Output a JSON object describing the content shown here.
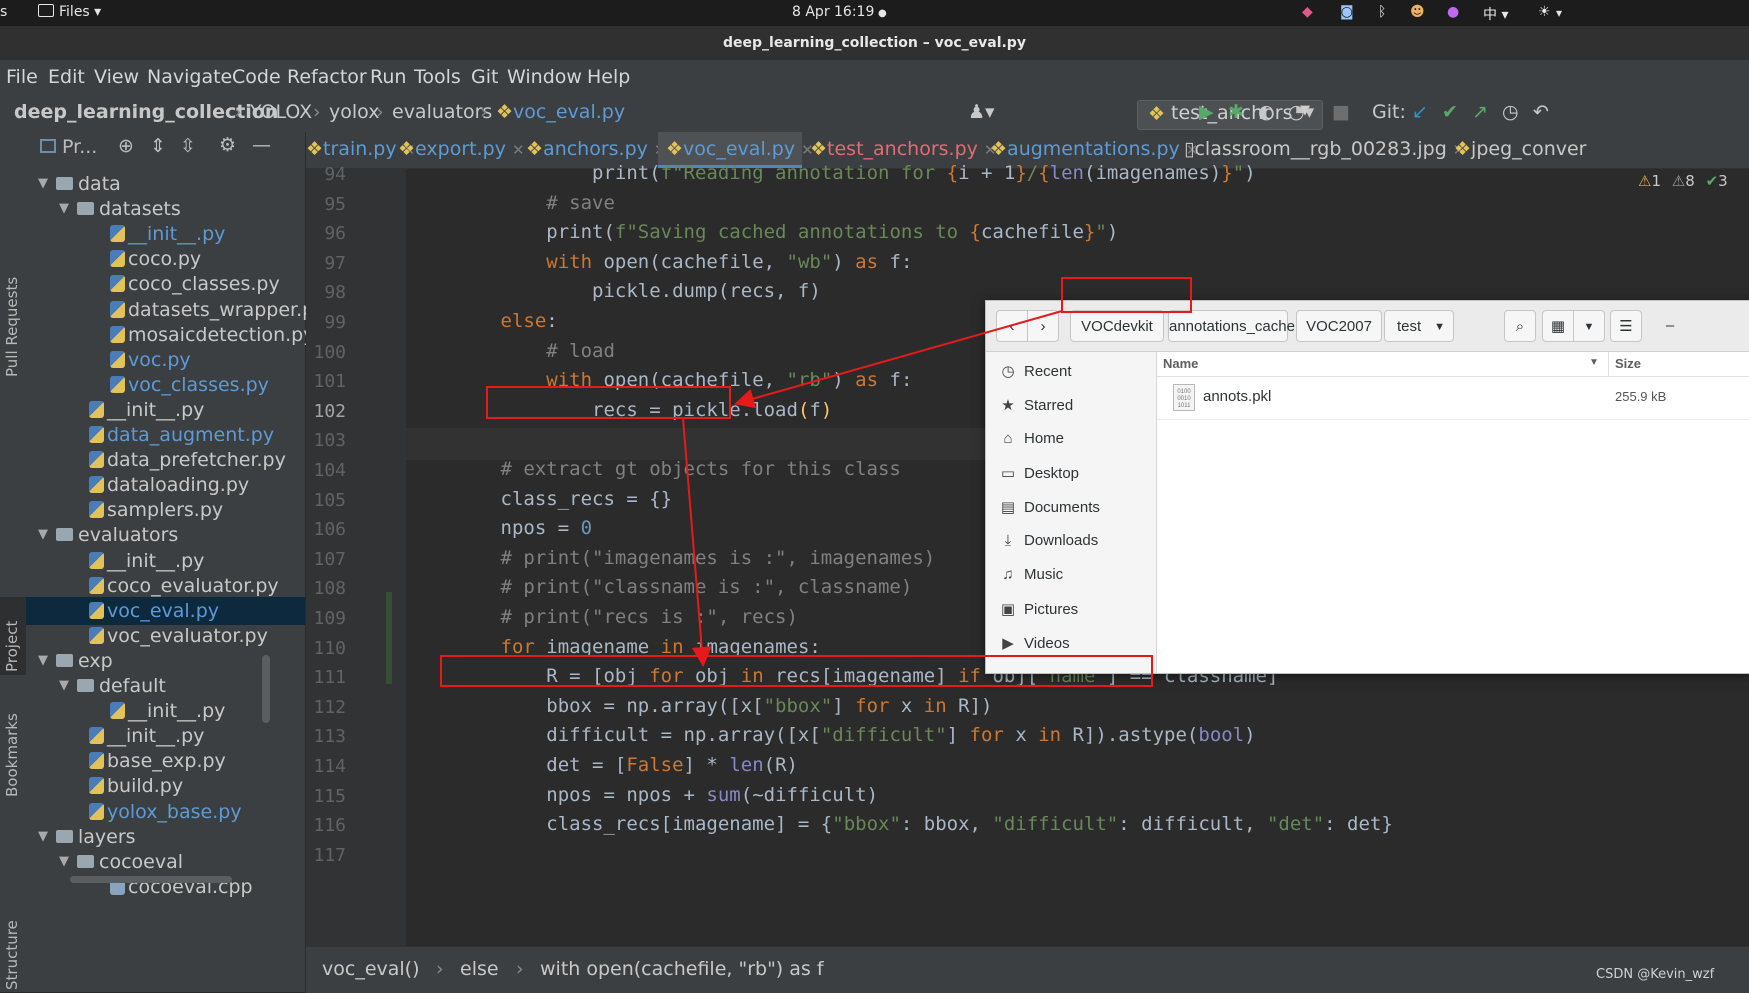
{
  "system_bar": {
    "activities": "s",
    "files_menu": "Files ▾",
    "datetime": "8 Apr  16:19",
    "input_method": "中 ▾"
  },
  "window": {
    "title": "deep_learning_collection – voc_eval.py"
  },
  "menu": [
    "File",
    "Edit",
    "View",
    "Navigate",
    "Code",
    "Refactor",
    "Run",
    "Tools",
    "Git",
    "Window",
    "Help"
  ],
  "breadcrumb": [
    "deep_learning_collection",
    "YOLOX",
    "yolox",
    "evaluators",
    "voc_eval.py"
  ],
  "toolbar": {
    "run_config": "test_anchors",
    "git_label": "Git:"
  },
  "project_panel": {
    "title": "Pr...",
    "tree": [
      {
        "label": "data",
        "type": "folder",
        "depth": 0,
        "expanded": true
      },
      {
        "label": "datasets",
        "type": "folder",
        "depth": 1,
        "expanded": true
      },
      {
        "label": "__init__.py",
        "type": "py",
        "depth": 2,
        "color": "blue"
      },
      {
        "label": "coco.py",
        "type": "py",
        "depth": 2
      },
      {
        "label": "coco_classes.py",
        "type": "py",
        "depth": 2
      },
      {
        "label": "datasets_wrapper.p",
        "type": "py",
        "depth": 2
      },
      {
        "label": "mosaicdetection.py",
        "type": "py",
        "depth": 2
      },
      {
        "label": "voc.py",
        "type": "py",
        "depth": 2,
        "color": "blue"
      },
      {
        "label": "voc_classes.py",
        "type": "py",
        "depth": 2,
        "color": "blue"
      },
      {
        "label": "__init__.py",
        "type": "py",
        "depth": 1
      },
      {
        "label": "data_augment.py",
        "type": "py",
        "depth": 1,
        "color": "blue"
      },
      {
        "label": "data_prefetcher.py",
        "type": "py",
        "depth": 1
      },
      {
        "label": "dataloading.py",
        "type": "py",
        "depth": 1
      },
      {
        "label": "samplers.py",
        "type": "py",
        "depth": 1
      },
      {
        "label": "evaluators",
        "type": "folder",
        "depth": 0,
        "expanded": true
      },
      {
        "label": "__init__.py",
        "type": "py",
        "depth": 1
      },
      {
        "label": "coco_evaluator.py",
        "type": "py",
        "depth": 1
      },
      {
        "label": "voc_eval.py",
        "type": "py",
        "depth": 1,
        "color": "blue",
        "selected": true
      },
      {
        "label": "voc_evaluator.py",
        "type": "py",
        "depth": 1
      },
      {
        "label": "exp",
        "type": "folder",
        "depth": 0,
        "expanded": true
      },
      {
        "label": "default",
        "type": "folder",
        "depth": 1,
        "expanded": true
      },
      {
        "label": "__init__.py",
        "type": "py",
        "depth": 2
      },
      {
        "label": "__init__.py",
        "type": "py",
        "depth": 1
      },
      {
        "label": "base_exp.py",
        "type": "py",
        "depth": 1
      },
      {
        "label": "build.py",
        "type": "py",
        "depth": 1
      },
      {
        "label": "yolox_base.py",
        "type": "py",
        "depth": 1,
        "color": "blue"
      },
      {
        "label": "layers",
        "type": "folder",
        "depth": 0,
        "expanded": true
      },
      {
        "label": "cocoeval",
        "type": "folder",
        "depth": 1,
        "expanded": true
      },
      {
        "label": "cocoeval.cpp",
        "type": "cpp",
        "depth": 2
      }
    ]
  },
  "side_labels": {
    "pull_requests": "Pull Requests",
    "project": "Project",
    "bookmarks": "Bookmarks",
    "structure": "Structure"
  },
  "tabs": [
    {
      "label": "train.py"
    },
    {
      "label": "export.py"
    },
    {
      "label": "anchors.py",
      "color": "blue"
    },
    {
      "label": "voc_eval.py",
      "color": "blue",
      "active": true
    },
    {
      "label": "test_anchors.py",
      "color": "red"
    },
    {
      "label": "augmentations.py",
      "color": "blue"
    },
    {
      "label": "classroom__rgb_00283.jpg"
    },
    {
      "label": "jpeg_conver"
    }
  ],
  "inspections": {
    "warnings_a": "1",
    "warnings_b": "8",
    "ok": "3"
  },
  "code": {
    "line_numbers": [
      "94",
      "95",
      "96",
      "97",
      "98",
      "99",
      "100",
      "101",
      "102",
      "103",
      "104",
      "105",
      "106",
      "107",
      "108",
      "109",
      "110",
      "111",
      "112",
      "113",
      "114",
      "115",
      "116",
      "117"
    ],
    "lines": [
      [
        {
          "t": "                print(",
          "c": ""
        },
        {
          "t": "f\"Reading annotation for ",
          "c": "str"
        },
        {
          "t": "{",
          "c": "kw"
        },
        {
          "t": "i + 1",
          "c": ""
        },
        {
          "t": "}",
          "c": "kw"
        },
        {
          "t": "/",
          "c": "str"
        },
        {
          "t": "{",
          "c": "kw"
        },
        {
          "t": "len",
          "c": "fn"
        },
        {
          "t": "(imagenames)",
          "c": ""
        },
        {
          "t": "}",
          "c": "kw"
        },
        {
          "t": "\"",
          "c": "str"
        },
        {
          "t": ")",
          "c": ""
        }
      ],
      [
        {
          "t": "            # save",
          "c": "cm"
        }
      ],
      [
        {
          "t": "            print(",
          "c": ""
        },
        {
          "t": "f\"Saving cached annotations to ",
          "c": "str"
        },
        {
          "t": "{",
          "c": "kw"
        },
        {
          "t": "cachefile",
          "c": ""
        },
        {
          "t": "}",
          "c": "kw"
        },
        {
          "t": "\"",
          "c": "str"
        },
        {
          "t": ")",
          "c": ""
        }
      ],
      [
        {
          "t": "            ",
          "c": ""
        },
        {
          "t": "with ",
          "c": "kw"
        },
        {
          "t": "open(cachefile, ",
          "c": ""
        },
        {
          "t": "\"wb\"",
          "c": "str"
        },
        {
          "t": ") ",
          "c": ""
        },
        {
          "t": "as ",
          "c": "kw"
        },
        {
          "t": "f:",
          "c": ""
        }
      ],
      [
        {
          "t": "                pickle.dump(recs, f)",
          "c": ""
        }
      ],
      [
        {
          "t": "        ",
          "c": ""
        },
        {
          "t": "else",
          "c": "kw"
        },
        {
          "t": ":",
          "c": ""
        }
      ],
      [
        {
          "t": "            # load",
          "c": "cm"
        }
      ],
      [
        {
          "t": "            ",
          "c": ""
        },
        {
          "t": "with ",
          "c": "kw"
        },
        {
          "t": "open(cachefile, ",
          "c": ""
        },
        {
          "t": "\"rb\"",
          "c": "str"
        },
        {
          "t": ") ",
          "c": ""
        },
        {
          "t": "as ",
          "c": "kw"
        },
        {
          "t": "f:",
          "c": ""
        }
      ],
      [
        {
          "t": "                recs = pickle.load",
          "c": ""
        },
        {
          "t": "(",
          "c": "fs"
        },
        {
          "t": "f",
          "c": ""
        },
        {
          "t": ")",
          "c": "fs"
        }
      ],
      [
        {
          "t": "",
          "c": ""
        }
      ],
      [
        {
          "t": "        # extract gt objects for this class",
          "c": "cm"
        }
      ],
      [
        {
          "t": "        class_recs = {}",
          "c": ""
        }
      ],
      [
        {
          "t": "        npos = ",
          "c": ""
        },
        {
          "t": "0",
          "c": "num"
        }
      ],
      [
        {
          "t": "        # print(\"imagenames is :\", imagenames)",
          "c": "cm"
        }
      ],
      [
        {
          "t": "        # print(\"classname is :\", classname)",
          "c": "cm"
        }
      ],
      [
        {
          "t": "        # print(\"recs is :\", recs)",
          "c": "cm"
        }
      ],
      [
        {
          "t": "        ",
          "c": ""
        },
        {
          "t": "for ",
          "c": "kw"
        },
        {
          "t": "imagename ",
          "c": ""
        },
        {
          "t": "in ",
          "c": "kw"
        },
        {
          "t": "imagenames:",
          "c": ""
        }
      ],
      [
        {
          "t": "            R = [obj ",
          "c": ""
        },
        {
          "t": "for ",
          "c": "kw"
        },
        {
          "t": "obj ",
          "c": ""
        },
        {
          "t": "in ",
          "c": "kw"
        },
        {
          "t": "recs[imagename] ",
          "c": ""
        },
        {
          "t": "if ",
          "c": "kw"
        },
        {
          "t": "obj[",
          "c": ""
        },
        {
          "t": "\"name\"",
          "c": "str"
        },
        {
          "t": "] == classname]",
          "c": ""
        }
      ],
      [
        {
          "t": "            bbox = np.array([x[",
          "c": ""
        },
        {
          "t": "\"bbox\"",
          "c": "str"
        },
        {
          "t": "] ",
          "c": ""
        },
        {
          "t": "for ",
          "c": "kw"
        },
        {
          "t": "x ",
          "c": ""
        },
        {
          "t": "in ",
          "c": "kw"
        },
        {
          "t": "R])",
          "c": ""
        }
      ],
      [
        {
          "t": "            difficult = np.array([x[",
          "c": ""
        },
        {
          "t": "\"difficult\"",
          "c": "str"
        },
        {
          "t": "] ",
          "c": ""
        },
        {
          "t": "for ",
          "c": "kw"
        },
        {
          "t": "x ",
          "c": ""
        },
        {
          "t": "in ",
          "c": "kw"
        },
        {
          "t": "R]).astype(",
          "c": ""
        },
        {
          "t": "bool",
          "c": "fn"
        },
        {
          "t": ")",
          "c": ""
        }
      ],
      [
        {
          "t": "            det = [",
          "c": ""
        },
        {
          "t": "False",
          "c": "kw"
        },
        {
          "t": "] * ",
          "c": ""
        },
        {
          "t": "len",
          "c": "fn"
        },
        {
          "t": "(R)",
          "c": ""
        }
      ],
      [
        {
          "t": "            npos = npos + ",
          "c": ""
        },
        {
          "t": "sum",
          "c": "fn"
        },
        {
          "t": "(~difficult)",
          "c": ""
        }
      ],
      [
        {
          "t": "            class_recs[imagename] = {",
          "c": ""
        },
        {
          "t": "\"bbox\"",
          "c": "str"
        },
        {
          "t": ": bbox, ",
          "c": ""
        },
        {
          "t": "\"difficult\"",
          "c": "str"
        },
        {
          "t": ": difficult, ",
          "c": ""
        },
        {
          "t": "\"det\"",
          "c": "str"
        },
        {
          "t": ": det}",
          "c": ""
        }
      ],
      [
        {
          "t": "",
          "c": ""
        }
      ]
    ]
  },
  "status_breadcrumb": [
    "voc_eval()",
    "else",
    "with open(cachefile, \"rb\") as f"
  ],
  "watermark": "CSDN @Kevin_wzf",
  "file_dialog": {
    "path": [
      "VOCdevkit",
      "annotations_cache",
      "VOC2007",
      "test"
    ],
    "places": [
      {
        "label": "Recent",
        "icon": "recent-icon",
        "glyph": "◷"
      },
      {
        "label": "Starred",
        "icon": "star-icon",
        "glyph": "★"
      },
      {
        "label": "Home",
        "icon": "home-icon",
        "glyph": "⌂"
      },
      {
        "label": "Desktop",
        "icon": "desktop-icon",
        "glyph": "▭"
      },
      {
        "label": "Documents",
        "icon": "documents-icon",
        "glyph": "▤"
      },
      {
        "label": "Downloads",
        "icon": "downloads-icon",
        "glyph": "⤓"
      },
      {
        "label": "Music",
        "icon": "music-icon",
        "glyph": "♫"
      },
      {
        "label": "Pictures",
        "icon": "pictures-icon",
        "glyph": "▣"
      },
      {
        "label": "Videos",
        "icon": "videos-icon",
        "glyph": "▶"
      }
    ],
    "columns": {
      "name": "Name",
      "size": "Size"
    },
    "files": [
      {
        "name": "annots.pkl",
        "size": "255.9 kB"
      }
    ]
  },
  "colors": {
    "annotation_red": "#e51a1a",
    "selection": "#0d293e",
    "accent": "#4a88c7"
  }
}
